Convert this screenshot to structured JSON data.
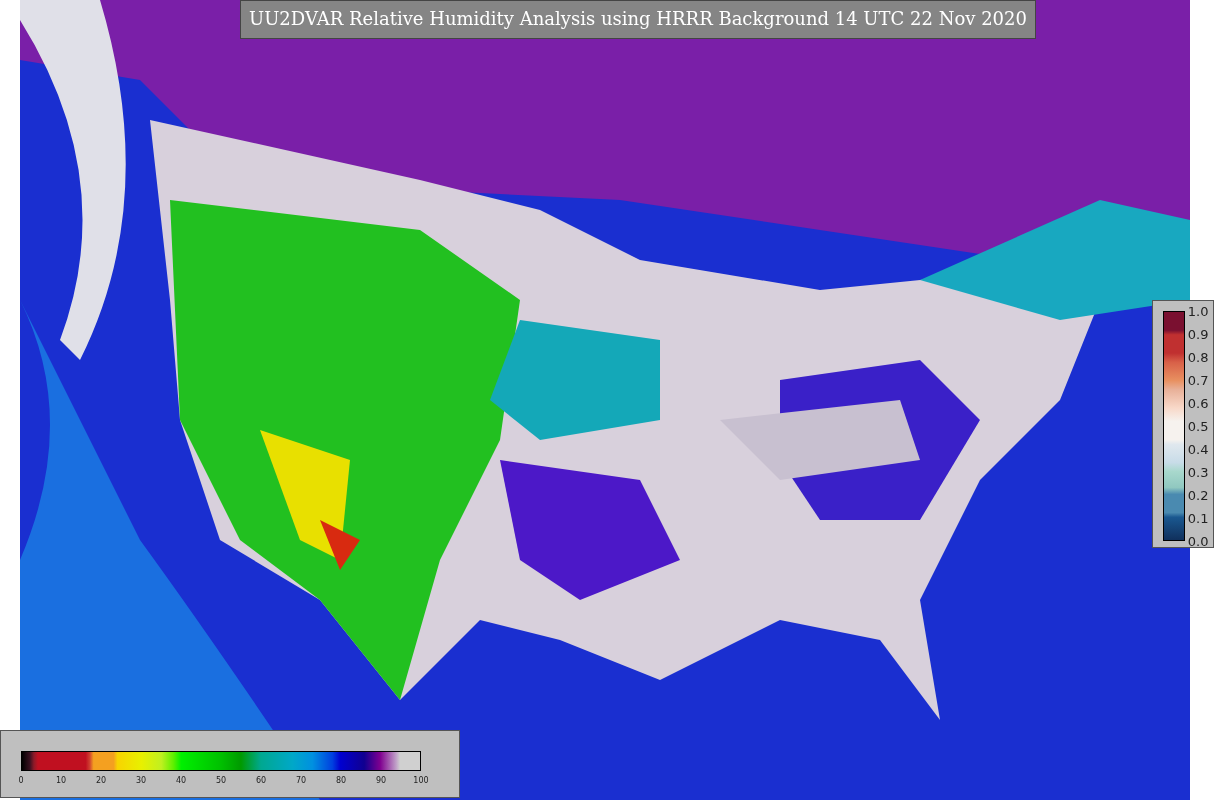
{
  "title": "UU2DVAR Relative Humidity Analysis using HRRR Background 14 UTC 22 Nov 2020",
  "colorbars": [
    {
      "kind": "horizontal",
      "ticks": [
        "0",
        "10",
        "20",
        "30",
        "40",
        "50",
        "60",
        "70",
        "80",
        "90",
        "100"
      ]
    },
    {
      "kind": "vertical",
      "ticks": [
        "1.0",
        "0.9",
        "0.8",
        "0.7",
        "0.6",
        "0.5",
        "0.4",
        "0.3",
        "0.2",
        "0.1",
        "0.0"
      ]
    }
  ]
}
